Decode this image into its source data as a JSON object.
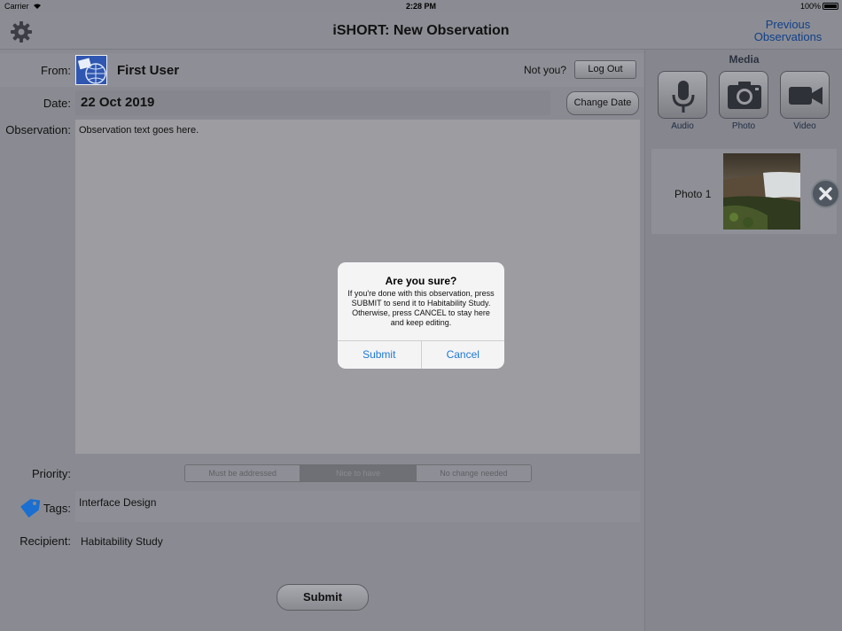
{
  "status_bar": {
    "carrier": "Carrier",
    "time": "2:28 PM",
    "battery": "100%"
  },
  "nav": {
    "title": "iSHORT: New Observation",
    "previous_line1": "Previous",
    "previous_line2": "Observations"
  },
  "form": {
    "from_label": "From:",
    "user_name": "First User",
    "not_you": "Not you?",
    "logout_label": "Log Out",
    "date_label": "Date:",
    "date_value": "22 Oct 2019",
    "change_date_label": "Change Date",
    "observation_label": "Observation:",
    "observation_text": "Observation text goes here.",
    "priority_label": "Priority:",
    "priority_options": [
      "Must be addressed",
      "Nice to have",
      "No change needed"
    ],
    "priority_selected": "Nice to have",
    "tags_label": "Tags:",
    "tags_value": "Interface Design",
    "recipient_label": "Recipient:",
    "recipient_value": "Habitability Study",
    "submit_label": "Submit"
  },
  "media": {
    "title": "Media",
    "buttons": [
      {
        "label": "Audio",
        "icon": "microphone-icon"
      },
      {
        "label": "Photo",
        "icon": "camera-icon"
      },
      {
        "label": "Video",
        "icon": "video-camera-icon"
      }
    ],
    "items": [
      {
        "label": "Photo 1"
      }
    ]
  },
  "dialog": {
    "title": "Are you sure?",
    "message": "If you're done with this observation, press SUBMIT to send it to Habitability Study. Otherwise, press CANCEL to stay here and keep editing.",
    "submit_label": "Submit",
    "cancel_label": "Cancel"
  },
  "colors": {
    "link": "#10408a",
    "dialog_action": "#1e78d6",
    "background": "#8a8b92"
  }
}
